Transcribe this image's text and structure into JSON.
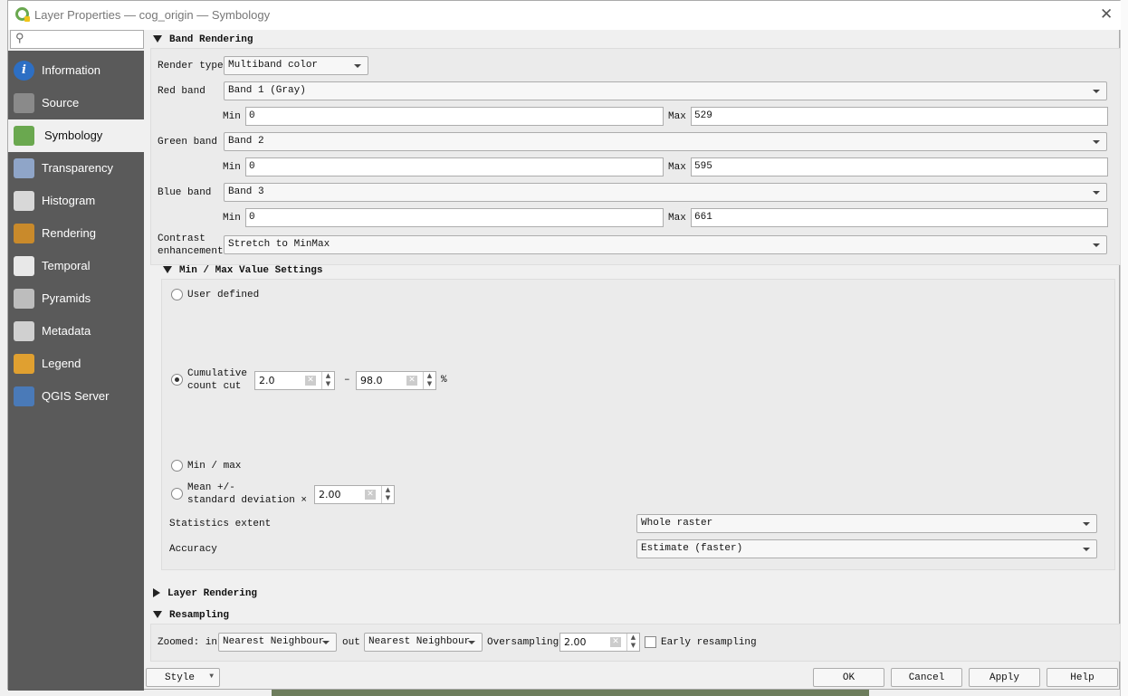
{
  "window": {
    "title": "Layer Properties — cog_origin — Symbology",
    "close_icon": "close-icon"
  },
  "search": {
    "placeholder": "",
    "icon": "search-icon"
  },
  "sidebar": {
    "items": [
      {
        "label": "Information",
        "icon": "information-icon",
        "color": "#2d6fc4"
      },
      {
        "label": "Source",
        "icon": "source-icon",
        "color": "#8a8a8a"
      },
      {
        "label": "Symbology",
        "icon": "symbology-icon",
        "color": "#6aa84f",
        "selected": true
      },
      {
        "label": "Transparency",
        "icon": "transparency-icon",
        "color": "#8fa5c8"
      },
      {
        "label": "Histogram",
        "icon": "histogram-icon",
        "color": "#d8d8d8"
      },
      {
        "label": "Rendering",
        "icon": "rendering-icon",
        "color": "#c98a2b"
      },
      {
        "label": "Temporal",
        "icon": "temporal-icon",
        "color": "#e8e8e8"
      },
      {
        "label": "Pyramids",
        "icon": "pyramids-icon",
        "color": "#bdbdbd"
      },
      {
        "label": "Metadata",
        "icon": "metadata-icon",
        "color": "#d0d0d0"
      },
      {
        "label": "Legend",
        "icon": "legend-icon",
        "color": "#e0a030"
      },
      {
        "label": "QGIS Server",
        "icon": "qgis-server-icon",
        "color": "#4a7ab8"
      }
    ]
  },
  "band_rendering": {
    "title": "Band Rendering",
    "render_type_label": "Render type",
    "render_type": "Multiband color",
    "red_label": "Red band",
    "red_band": "Band 1 (Gray)",
    "red_min": "0",
    "red_max": "529",
    "green_label": "Green band",
    "green_band": "Band 2",
    "green_min": "0",
    "green_max": "595",
    "blue_label": "Blue band",
    "blue_band": "Band 3",
    "blue_min": "0",
    "blue_max": "661",
    "min_label": "Min",
    "max_label": "Max",
    "contrast_label_1": "Contrast",
    "contrast_label_2": "enhancement",
    "contrast": "Stretch to MinMax"
  },
  "minmax": {
    "title": "Min / Max Value Settings",
    "user_defined": "User defined",
    "cumulative_1": "Cumulative",
    "cumulative_2": "count cut",
    "cut_low": "2.0",
    "cut_high": "98.0",
    "dash": "–",
    "percent": "%",
    "min_max": "Min / max",
    "mean_1": "Mean +/-",
    "mean_2": "standard deviation ×",
    "stddev": "2.00",
    "selected": "Cumulative count cut",
    "stats_extent_label": "Statistics extent",
    "stats_extent": "Whole raster",
    "accuracy_label": "Accuracy",
    "accuracy": "Estimate (faster)"
  },
  "layer_rendering": {
    "title": "Layer Rendering"
  },
  "resampling": {
    "title": "Resampling",
    "zoomed_in_label": "Zoomed: in",
    "zoomed_in": "Nearest Neighbour",
    "out_label": "out",
    "zoomed_out": "Nearest Neighbour",
    "oversampling_label": "Oversampling",
    "oversampling": "2.00",
    "early_label": "Early resampling",
    "early_checked": false
  },
  "footer": {
    "style": "Style",
    "ok": "OK",
    "cancel": "Cancel",
    "apply": "Apply",
    "help": "Help"
  }
}
